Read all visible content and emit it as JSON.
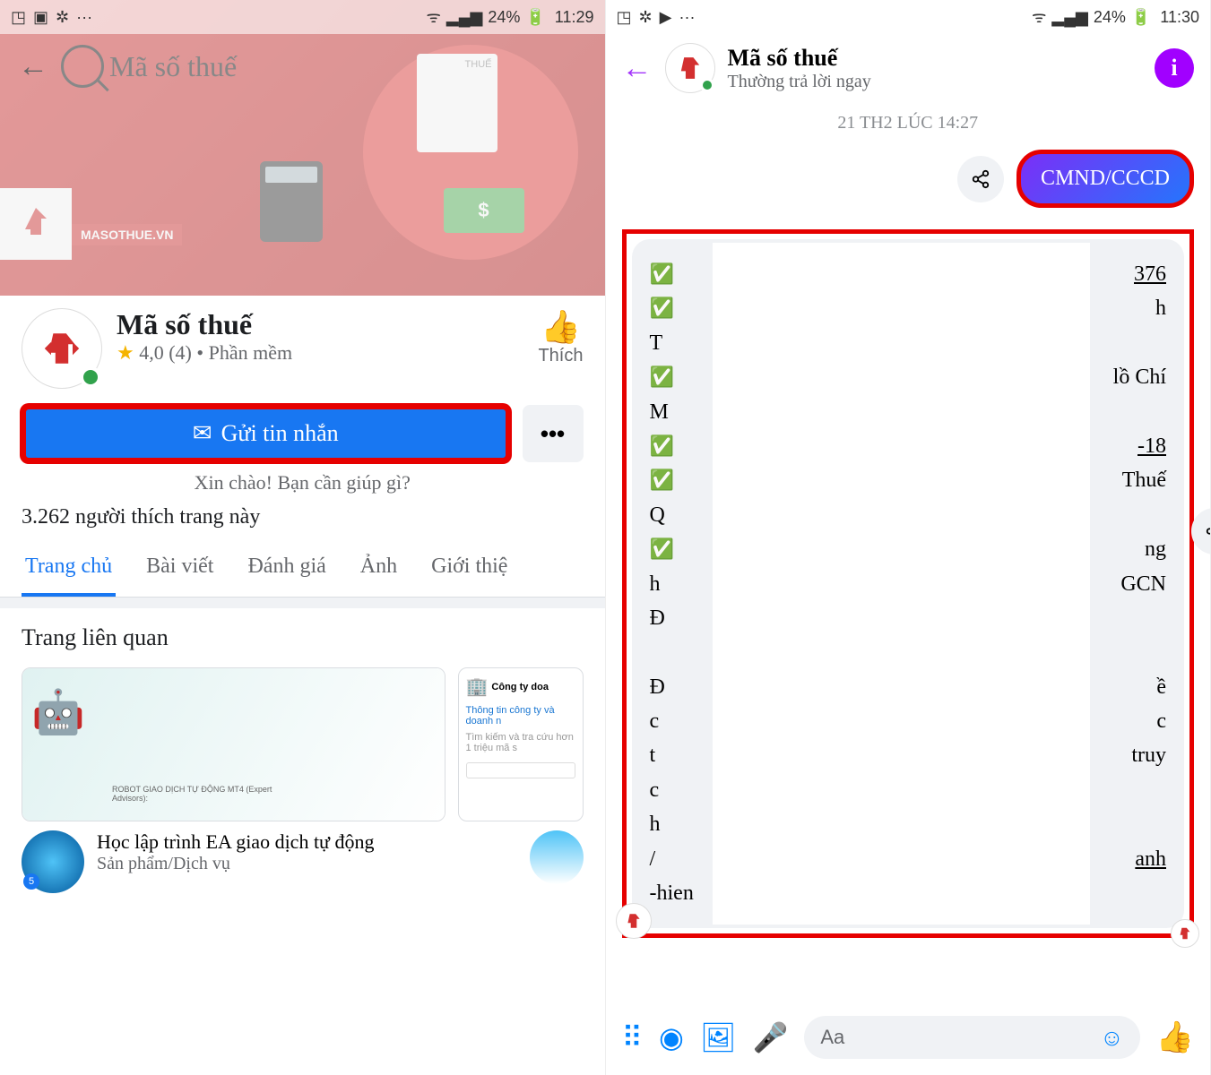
{
  "left": {
    "status": {
      "battery": "24%",
      "time": "11:29"
    },
    "search_placeholder": "Mã số thuế",
    "cover": {
      "thue_label": "THUẾ",
      "brand": "MASOTHUE.VN"
    },
    "page": {
      "title": "Mã số thuế",
      "rating": "4,0 (4)",
      "category": "Phần mềm",
      "like_label": "Thích"
    },
    "send_msg_label": "Gửi tin nhắn",
    "greeting": "Xin chào! Bạn cần giúp gì?",
    "likes_line": "3.262 người thích trang này",
    "tabs": [
      "Trang chủ",
      "Bài viết",
      "Đánh giá",
      "Ảnh",
      "Giới thiệ"
    ],
    "related_title": "Trang liên quan",
    "related": [
      {
        "img_text": "ROBOT GIAO DỊCH TỰ ĐỘNG MT4 (Expert Advisors):",
        "name": "Học lập trình EA giao dịch tự động",
        "type": "Sản phẩm/Dịch vụ"
      },
      {
        "header": "Công ty doa",
        "line1": "Thông tin công ty và doanh n",
        "line2": "Tìm kiếm và tra cứu hơn 1 triệu mã s"
      }
    ]
  },
  "right": {
    "status": {
      "battery": "24%",
      "time": "11:30"
    },
    "header": {
      "title": "Mã số thuế",
      "sub": "Thường trả lời ngay"
    },
    "timestamp": "21 TH2 LÚC 14:27",
    "sent_text": "CMND/CCCD",
    "recv_left_fragments": [
      "✅",
      "✅",
      "T",
      "✅",
      "M",
      "✅",
      "✅",
      "Q",
      "✅",
      "h",
      "Đ",
      "",
      "Đ",
      "c",
      "t",
      "c",
      "h",
      "/",
      "-hien"
    ],
    "recv_right_fragments": [
      "376",
      "h",
      "",
      "lồ Chí",
      "",
      "-18",
      "Thuế",
      "",
      "ng",
      "GCN",
      "",
      "",
      "ề",
      "c",
      "truy",
      "",
      "",
      "anh",
      ""
    ],
    "input_placeholder": "Aa"
  }
}
